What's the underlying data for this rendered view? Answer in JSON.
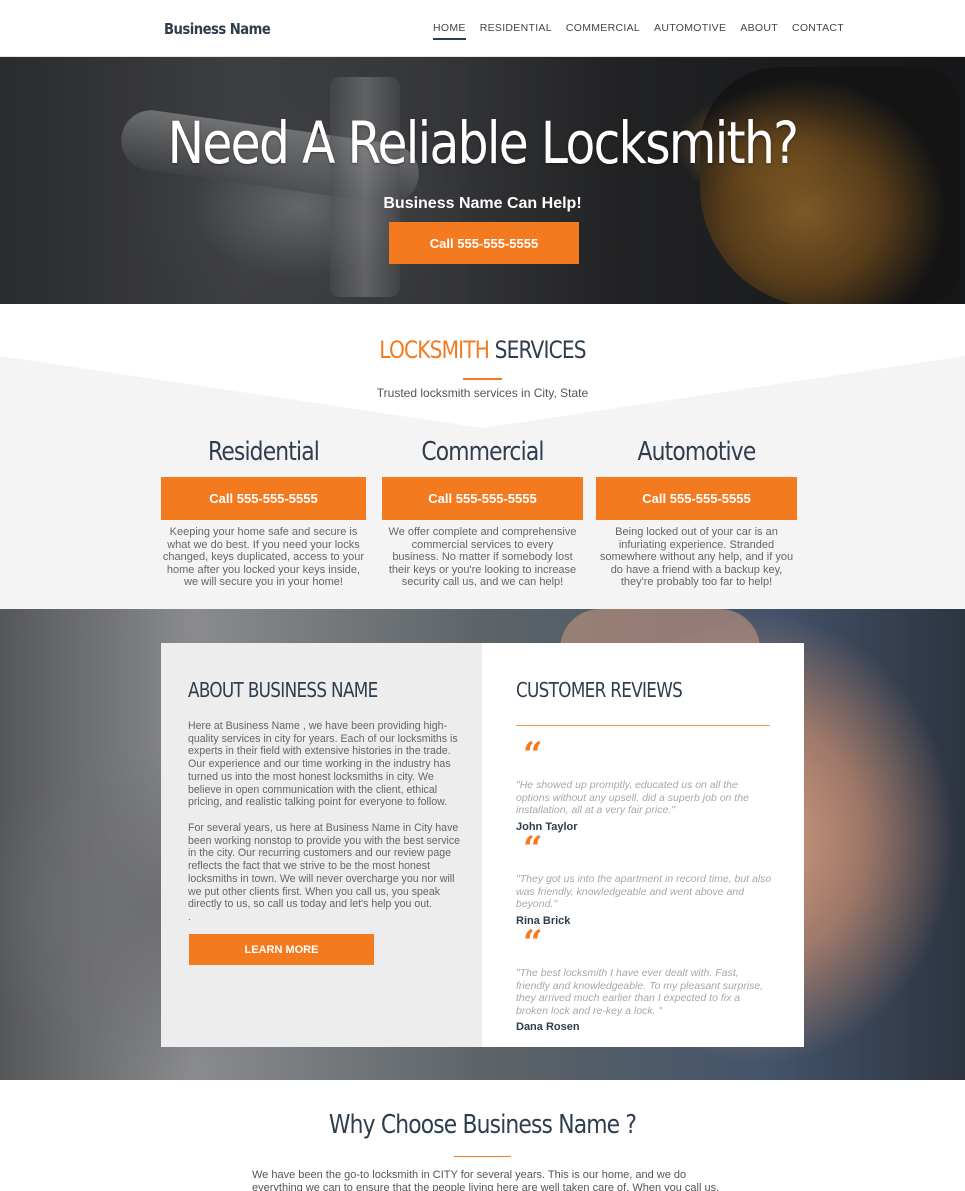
{
  "nav": {
    "brand": "Business Name",
    "items": [
      {
        "label": "HOME",
        "active": true
      },
      {
        "label": "RESIDENTIAL",
        "active": false
      },
      {
        "label": "COMMERCIAL",
        "active": false
      },
      {
        "label": "AUTOMOTIVE",
        "active": false
      },
      {
        "label": "ABOUT",
        "active": false
      },
      {
        "label": "CONTACT",
        "active": false
      }
    ]
  },
  "hero": {
    "headline": "Need A Reliable Locksmith?",
    "subheadline": "Business Name Can Help!",
    "cta": "Call 555-555-5555"
  },
  "services": {
    "title_accent": "LOCKSMITH",
    "title_rest": " SERVICES",
    "subtitle": "Trusted locksmith services in City, State",
    "items": [
      {
        "name": "Residential",
        "cta": "Call 555-555-5555",
        "description": "Keeping your home safe and secure is what we do best. If you need your locks changed, keys duplicated, access to your home after you locked your keys inside, we will secure you in your home!"
      },
      {
        "name": "Commercial",
        "cta": "Call 555-555-5555",
        "description": "We offer complete and comprehensive commercial services to every business. No matter if somebody lost their keys or you're looking to increase security call us, and we can help!"
      },
      {
        "name": "Automotive",
        "cta": "Call 555-555-5555",
        "description": "Being locked out of your car is an infuriating experience. Stranded somewhere without any help, and if you do have a friend with a backup key, they're probably too far to help!"
      }
    ]
  },
  "about": {
    "title": "ABOUT BUSINESS NAME",
    "paragraph1": "Here at Business Name , we have been providing high-quality services in city for years. Each of our locksmiths is experts in their field with extensive histories in the trade. Our experience and our time working in the industry has turned us into the most honest locksmiths in city. We believe in open communication with the client, ethical pricing, and realistic talking point for everyone to follow.",
    "paragraph2": "For several years, us here at Business Name in City have been working nonstop to provide you with the best service in the city. Our recurring customers and our review page reflects the fact that we strive to be the most honest locksmiths in town. We will never overcharge you nor will we put other clients first. When you call us, you speak directly to us, so call us today and let's help you out.",
    "trailing": ".",
    "button": "LEARN MORE"
  },
  "reviews": {
    "title": "CUSTOMER REVIEWS",
    "quote_glyph": "“",
    "items": [
      {
        "text": "\"He showed up promptly, educated us on all the options without any upsell, did a superb job on the installation, all at a very fair price.\"",
        "author": "John Taylor"
      },
      {
        "text": "\"They got us into the apartment in record time, but also was friendly, knowledgeable and went above and beyond.\"",
        "author": "Rina Brick"
      },
      {
        "text": "\"The best locksmith I have ever dealt with. Fast, friendly and knowledgeable.  To my pleasant surprise, they arrived much earlier than I expected to fix a broken lock and re-key a lock. \"",
        "author": "Dana Rosen"
      }
    ]
  },
  "why": {
    "title": "Why Choose Business Name ?",
    "text": "We have been the go-to locksmith in CITY for several years. This is our home, and we do everything we can to ensure that the people living here are well taken care of. When you call us, you are calling"
  },
  "colors": {
    "accent": "#f47a20",
    "heading": "#2f3e4e"
  }
}
